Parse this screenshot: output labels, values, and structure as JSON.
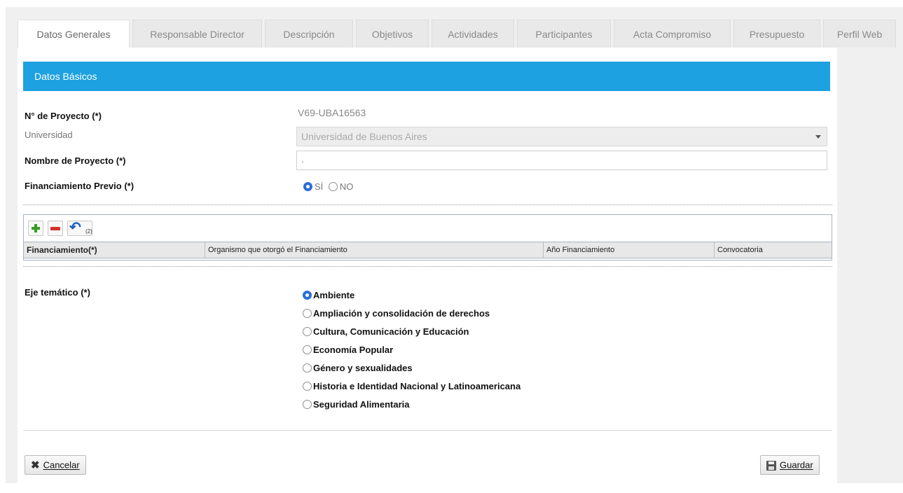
{
  "tabs": [
    {
      "label": "Datos Generales",
      "active": true
    },
    {
      "label": "Responsable Director",
      "active": false
    },
    {
      "label": "Descripción",
      "active": false
    },
    {
      "label": "Objetivos",
      "active": false
    },
    {
      "label": "Actividades",
      "active": false
    },
    {
      "label": "Participantes",
      "active": false
    },
    {
      "label": "Acta Compromiso",
      "active": false
    },
    {
      "label": "Presupuesto",
      "active": false
    },
    {
      "label": "Perfil Web",
      "active": false
    }
  ],
  "section_title": "Datos Básicos",
  "form": {
    "proyecto_label": "N° de Proyecto (*)",
    "proyecto_value": "V69-UBA16563",
    "universidad_label": "Universidad",
    "universidad_value": "Universidad de Buenos Aires",
    "nombre_label": "Nombre de Proyecto (*)",
    "nombre_value": ".",
    "financiamiento_label": "Financiamiento Previo (*)",
    "fin_si": "SÍ",
    "fin_no": "NO",
    "fin_selected": "SÍ"
  },
  "grid": {
    "undo_count": "(2)",
    "columns": [
      "Financiamiento(*)",
      "Organismo que otorgó el Financiamiento",
      "Año Financiamiento",
      "Convocatoria"
    ]
  },
  "eje": {
    "label": "Eje temático (*)",
    "options": [
      "Ambiente",
      "Ampliación y consolidación de derechos",
      "Cultura, Comunicación y Educación",
      "Economía Popular",
      "Género y sexualidades",
      "Historia e Identidad Nacional y Latinoamericana",
      "Seguridad Alimentaria"
    ],
    "selected": "Ambiente"
  },
  "buttons": {
    "cancel": "Cancelar",
    "save": "Guardar"
  },
  "colors": {
    "header_blue": "#1da1e0",
    "radio_on": "#2b6fd6"
  }
}
